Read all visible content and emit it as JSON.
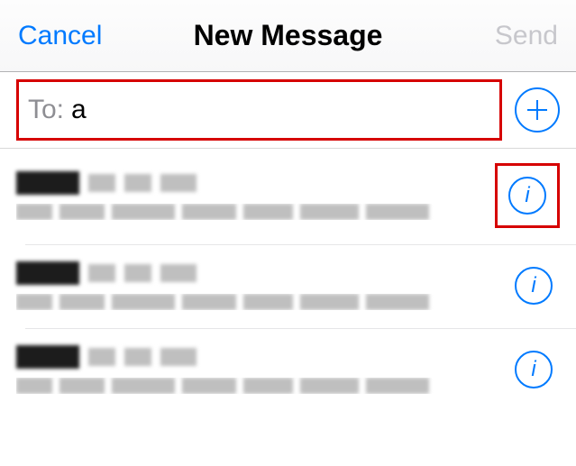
{
  "navbar": {
    "cancel": "Cancel",
    "title": "New Message",
    "send": "Send"
  },
  "compose": {
    "to_label": "To:",
    "to_value": "a"
  },
  "highlight_colors": {
    "callout": "#d60000",
    "tint": "#007aff"
  },
  "results": [
    {
      "info_highlighted": true
    },
    {
      "info_highlighted": false
    },
    {
      "info_highlighted": false
    }
  ]
}
